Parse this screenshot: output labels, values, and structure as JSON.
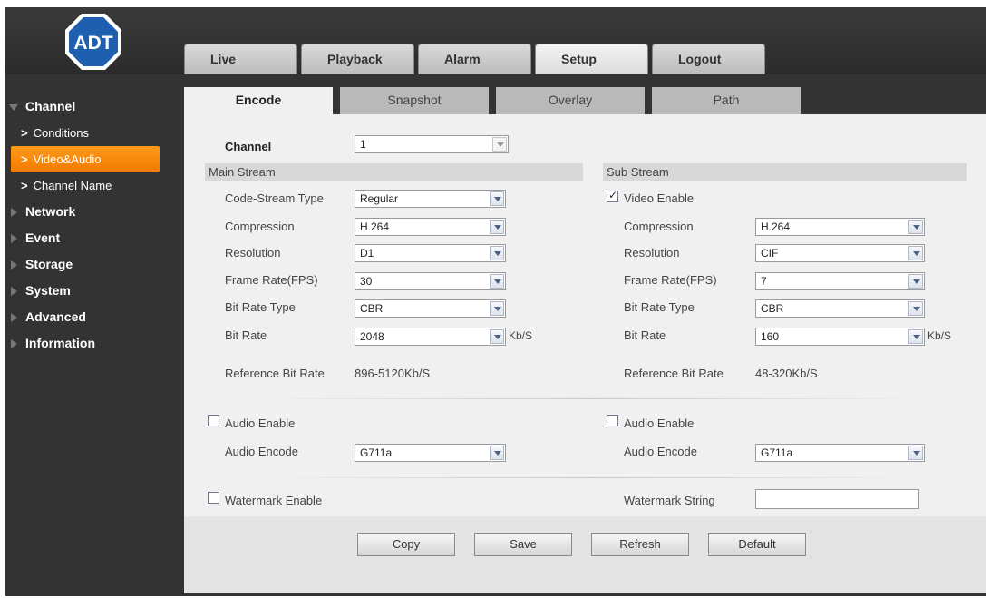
{
  "logo_text": "ADT",
  "main_tabs": [
    "Live",
    "Playback",
    "Alarm",
    "Setup",
    "Logout"
  ],
  "active_main_tab": "Setup",
  "sidebar": {
    "channel": "Channel",
    "sub_items": [
      "Conditions",
      "Video&Audio",
      "Channel Name"
    ],
    "items": [
      "Network",
      "Event",
      "Storage",
      "System",
      "Advanced",
      "Information"
    ]
  },
  "sub_tabs": [
    "Encode",
    "Snapshot",
    "Overlay",
    "Path"
  ],
  "channel": {
    "label": "Channel",
    "value": "1"
  },
  "main_stream": {
    "title": "Main Stream",
    "code_stream_type": {
      "label": "Code-Stream Type",
      "value": "Regular"
    },
    "compression": {
      "label": "Compression",
      "value": "H.264"
    },
    "resolution": {
      "label": "Resolution",
      "value": "D1"
    },
    "frame_rate": {
      "label": "Frame Rate(FPS)",
      "value": "30"
    },
    "bit_rate_type": {
      "label": "Bit Rate Type",
      "value": "CBR"
    },
    "bit_rate": {
      "label": "Bit Rate",
      "value": "2048",
      "unit": "Kb/S"
    },
    "reference_bit_rate": {
      "label": "Reference Bit Rate",
      "value": "896-5120Kb/S"
    },
    "audio_enable": {
      "label": "Audio Enable",
      "checked": false
    },
    "audio_encode": {
      "label": "Audio Encode",
      "value": "G711a"
    }
  },
  "sub_stream": {
    "title": "Sub Stream",
    "video_enable": {
      "label": "Video Enable",
      "checked": true
    },
    "compression": {
      "label": "Compression",
      "value": "H.264"
    },
    "resolution": {
      "label": "Resolution",
      "value": "CIF"
    },
    "frame_rate": {
      "label": "Frame Rate(FPS)",
      "value": "7"
    },
    "bit_rate_type": {
      "label": "Bit Rate Type",
      "value": "CBR"
    },
    "bit_rate": {
      "label": "Bit Rate",
      "value": "160",
      "unit": "Kb/S"
    },
    "reference_bit_rate": {
      "label": "Reference Bit Rate",
      "value": "48-320Kb/S"
    },
    "audio_enable": {
      "label": "Audio Enable",
      "checked": false
    },
    "audio_encode": {
      "label": "Audio Encode",
      "value": "G711a"
    }
  },
  "watermark": {
    "enable_label": "Watermark Enable",
    "enabled": false,
    "string_label": "Watermark String",
    "string_value": ""
  },
  "buttons": {
    "copy": "Copy",
    "save": "Save",
    "refresh": "Refresh",
    "default": "Default"
  },
  "colors": {
    "accent": "#f58a0b",
    "background": "#333333",
    "panel": "#f0f0f0"
  }
}
